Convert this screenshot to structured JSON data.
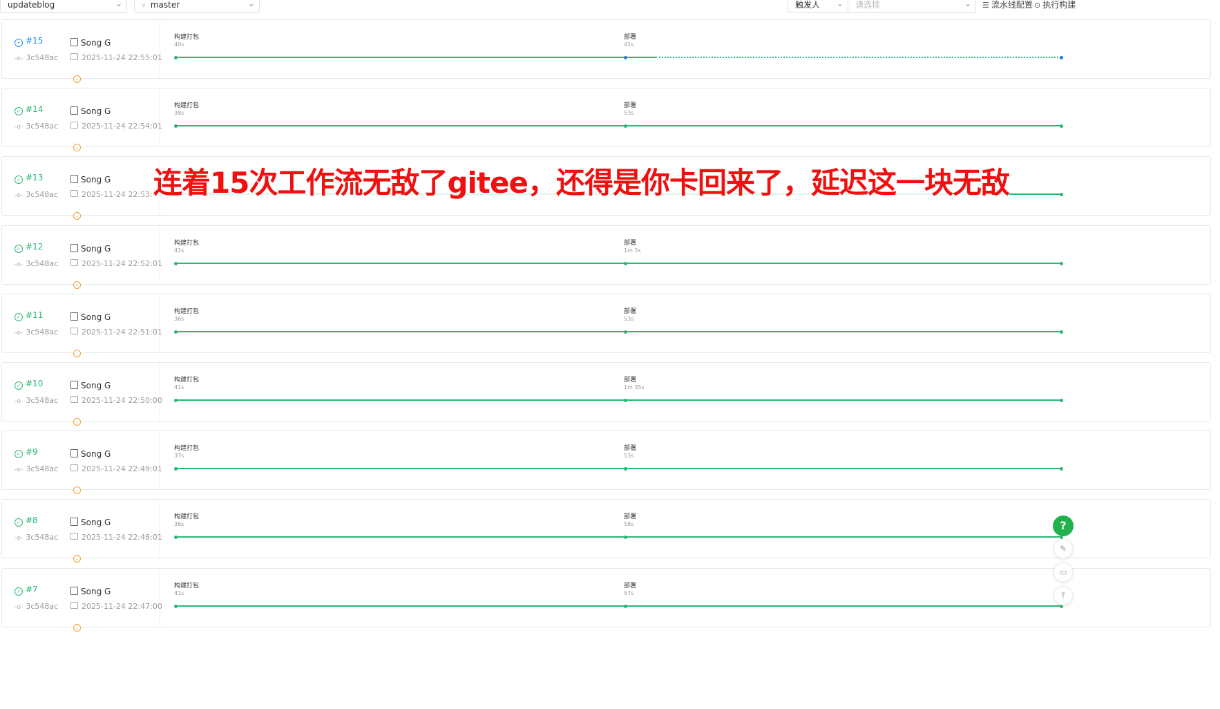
{
  "toolbar": {
    "repo": "updateblog",
    "branch": "master",
    "trigger_label": "触发人",
    "trigger_placeholder": "请选择",
    "pipeline_config": "流水线配置",
    "run_build": "执行构建"
  },
  "overlay_text": "连着15次工作流无敌了gitee，还得是你卡回来了，延迟这一块无敌",
  "colors": {
    "success": "#2bb673",
    "running": "#1890ff",
    "overlay": "#f01010",
    "expand": "#f0a030"
  },
  "runs": [
    {
      "id": "#15",
      "status": "running",
      "commit": "3c548ac",
      "author": "Song G",
      "time": "2025-11-24 22:55:01",
      "stages": [
        {
          "name": "构建打包",
          "duration": "40s"
        },
        {
          "name": "部署",
          "duration": "41s"
        }
      ]
    },
    {
      "id": "#14",
      "status": "success",
      "commit": "3c548ac",
      "author": "Song G",
      "time": "2025-11-24 22:54:01",
      "stages": [
        {
          "name": "构建打包",
          "duration": "38s"
        },
        {
          "name": "部署",
          "duration": "53s"
        }
      ]
    },
    {
      "id": "#13",
      "status": "success",
      "commit": "3c548ac",
      "author": "Song G",
      "time": "2025-11-24 22:53:01",
      "stages": []
    },
    {
      "id": "#12",
      "status": "success",
      "commit": "3c548ac",
      "author": "Song G",
      "time": "2025-11-24 22:52:01",
      "stages": [
        {
          "name": "构建打包",
          "duration": "41s"
        },
        {
          "name": "部署",
          "duration": "1m 5s"
        }
      ]
    },
    {
      "id": "#11",
      "status": "success",
      "commit": "3c548ac",
      "author": "Song G",
      "time": "2025-11-24 22:51:01",
      "stages": [
        {
          "name": "构建打包",
          "duration": "36s"
        },
        {
          "name": "部署",
          "duration": "53s"
        }
      ]
    },
    {
      "id": "#10",
      "status": "success",
      "commit": "3c548ac",
      "author": "Song G",
      "time": "2025-11-24 22:50:00",
      "stages": [
        {
          "name": "构建打包",
          "duration": "41s"
        },
        {
          "name": "部署",
          "duration": "1m 35s"
        }
      ]
    },
    {
      "id": "#9",
      "status": "success",
      "commit": "3c548ac",
      "author": "Song G",
      "time": "2025-11-24 22:49:01",
      "stages": [
        {
          "name": "构建打包",
          "duration": "37s"
        },
        {
          "name": "部署",
          "duration": "53s"
        }
      ]
    },
    {
      "id": "#8",
      "status": "success",
      "commit": "3c548ac",
      "author": "Song G",
      "time": "2025-11-24 22:48:01",
      "stages": [
        {
          "name": "构建打包",
          "duration": "36s"
        },
        {
          "name": "部署",
          "duration": "58s"
        }
      ]
    },
    {
      "id": "#7",
      "status": "success",
      "commit": "3c548ac",
      "author": "Song G",
      "time": "2025-11-24 22:47:00",
      "stages": [
        {
          "name": "构建打包",
          "duration": "41s"
        },
        {
          "name": "部署",
          "duration": "57s"
        }
      ]
    }
  ],
  "fabs": {
    "help": "?"
  }
}
